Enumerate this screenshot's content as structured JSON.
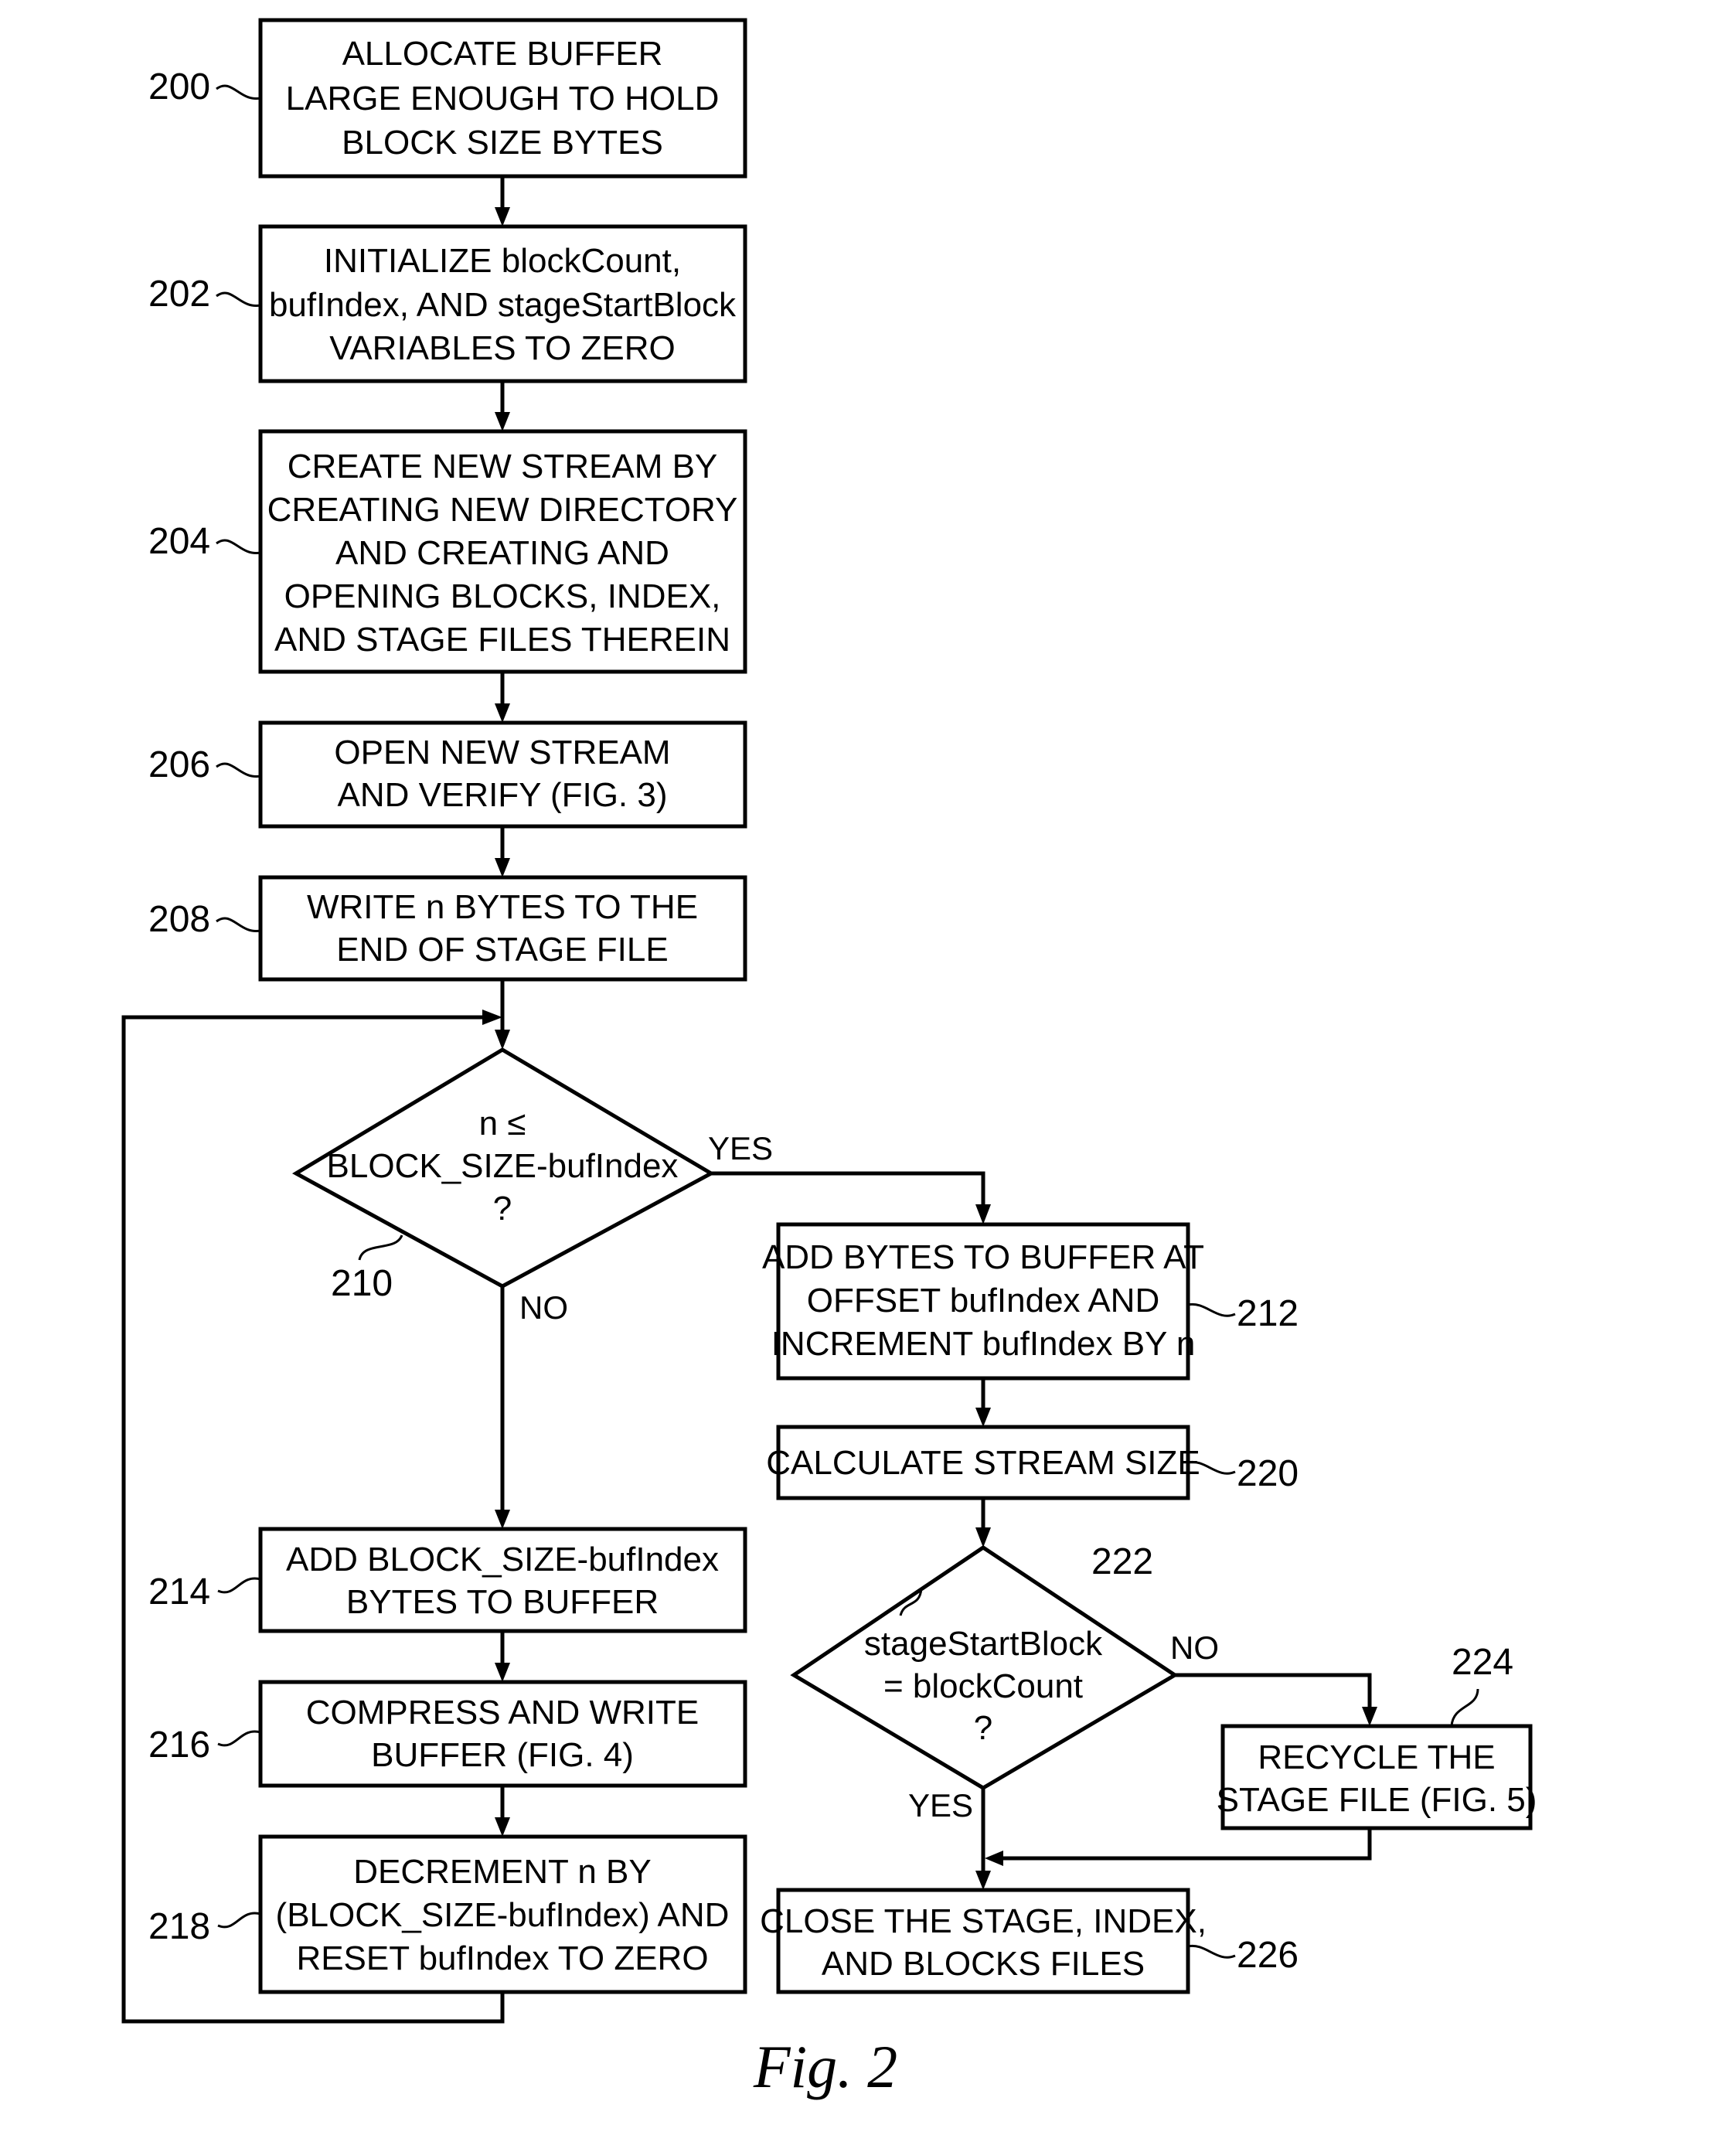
{
  "figure": {
    "caption": "Fig. 2",
    "steps": {
      "s200": {
        "ref": "200",
        "lines": [
          "ALLOCATE BUFFER",
          "LARGE ENOUGH TO HOLD",
          "BLOCK SIZE BYTES"
        ]
      },
      "s202": {
        "ref": "202",
        "lines": [
          "INITIALIZE blockCount,",
          "bufIndex, AND stageStartBlock",
          "VARIABLES TO ZERO"
        ]
      },
      "s204": {
        "ref": "204",
        "lines": [
          "CREATE NEW STREAM BY",
          "CREATING NEW DIRECTORY",
          "AND CREATING AND",
          "OPENING BLOCKS, INDEX,",
          "AND STAGE FILES THEREIN"
        ]
      },
      "s206": {
        "ref": "206",
        "lines": [
          "OPEN NEW STREAM",
          "AND VERIFY (FIG. 3)"
        ]
      },
      "s208": {
        "ref": "208",
        "lines": [
          "WRITE n BYTES TO THE",
          "END OF STAGE FILE"
        ]
      },
      "s210": {
        "ref": "210",
        "lines": [
          "n ≤",
          "BLOCK_SIZE-bufIndex",
          "?"
        ],
        "yes_label": "YES",
        "no_label": "NO"
      },
      "s212": {
        "ref": "212",
        "lines": [
          "ADD BYTES TO BUFFER AT",
          "OFFSET bufIndex AND",
          "INCREMENT bufIndex BY n"
        ]
      },
      "s214": {
        "ref": "214",
        "lines": [
          "ADD BLOCK_SIZE-bufIndex",
          "BYTES TO BUFFER"
        ]
      },
      "s216": {
        "ref": "216",
        "lines": [
          "COMPRESS AND WRITE",
          "BUFFER (FIG. 4)"
        ]
      },
      "s218": {
        "ref": "218",
        "lines": [
          "DECREMENT n BY",
          "(BLOCK_SIZE-bufIndex) AND",
          "RESET bufIndex TO ZERO"
        ]
      },
      "s220": {
        "ref": "220",
        "lines": [
          "CALCULATE STREAM SIZE"
        ]
      },
      "s222": {
        "ref": "222",
        "lines": [
          "stageStartBlock",
          "= blockCount",
          "?"
        ],
        "yes_label": "YES",
        "no_label": "NO"
      },
      "s224": {
        "ref": "224",
        "lines": [
          "RECYCLE THE",
          "STAGE FILE (FIG. 5)"
        ]
      },
      "s226": {
        "ref": "226",
        "lines": [
          "CLOSE THE STAGE, INDEX,",
          "AND BLOCKS FILES"
        ]
      }
    }
  }
}
